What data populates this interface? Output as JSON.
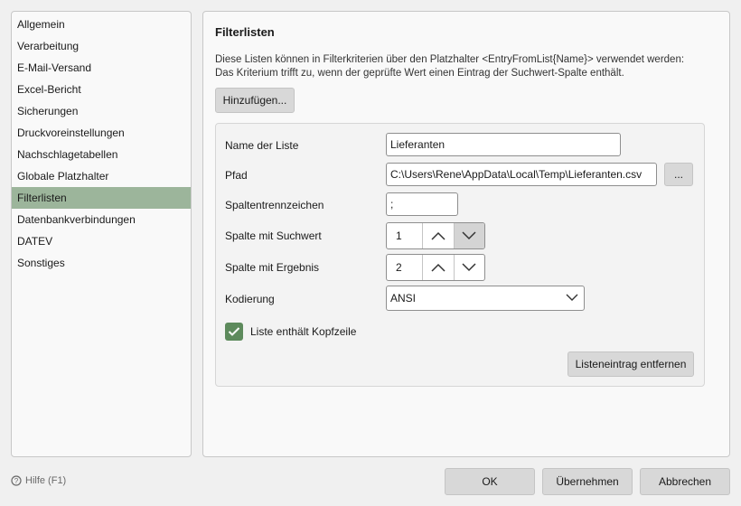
{
  "sidebar": {
    "items": [
      {
        "label": "Allgemein"
      },
      {
        "label": "Verarbeitung"
      },
      {
        "label": "E-Mail-Versand"
      },
      {
        "label": "Excel-Bericht"
      },
      {
        "label": "Sicherungen"
      },
      {
        "label": "Druckvoreinstellungen"
      },
      {
        "label": "Nachschlagetabellen"
      },
      {
        "label": "Globale Platzhalter"
      },
      {
        "label": "Filterlisten"
      },
      {
        "label": "Datenbankverbindungen"
      },
      {
        "label": "DATEV"
      },
      {
        "label": "Sonstiges"
      }
    ],
    "active_index": 8
  },
  "main": {
    "title": "Filterlisten",
    "description_line1": "Diese Listen können in Filterkriterien über den Platzhalter <EntryFromList{Name}> verwendet werden:",
    "description_line2": "Das Kriterium trifft zu, wenn der geprüfte Wert einen Eintrag der Suchwert-Spalte enthält.",
    "add_button": "Hinzufügen..."
  },
  "entry": {
    "name_label": "Name der Liste",
    "name_value": "Lieferanten",
    "path_label": "Pfad",
    "path_value": "C:\\Users\\Rene\\AppData\\Local\\Temp\\Lieferanten.csv",
    "browse_button": "...",
    "separator_label": "Spaltentrennzeichen",
    "separator_value": ";",
    "search_col_label": "Spalte mit Suchwert",
    "search_col_value": "1",
    "result_col_label": "Spalte mit Ergebnis",
    "result_col_value": "2",
    "encoding_label": "Kodierung",
    "encoding_value": "ANSI",
    "header_checkbox_label": "Liste enthält Kopfzeile",
    "header_checked": true,
    "remove_button": "Listeneintrag entfernen"
  },
  "footer": {
    "help": "Hilfe (F1)",
    "ok": "OK",
    "apply": "Übernehmen",
    "cancel": "Abbrechen"
  },
  "colors": {
    "active_item": "#9cb59b",
    "checkbox": "#5d8a5c"
  }
}
